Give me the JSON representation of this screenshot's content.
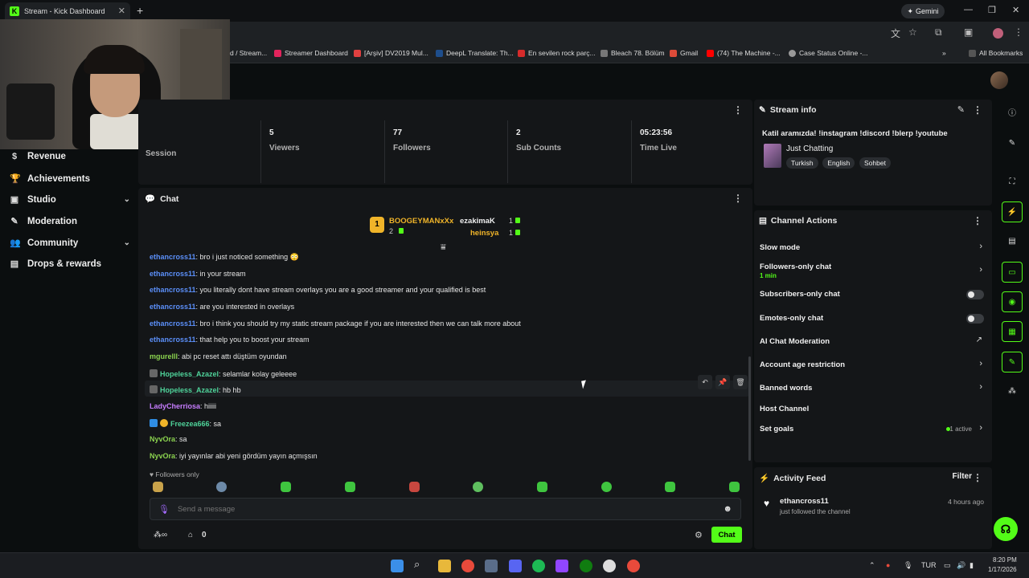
{
  "browser": {
    "tab_title": "Stream - Kick Dashboard",
    "tab_icon": "K",
    "new_tab": "+",
    "gemini_label": "Gemini",
    "bookmarks": [
      {
        "label": "d / Stream...",
        "color": "#444"
      },
      {
        "label": "Streamer Dashboard",
        "color": "#e2245c"
      },
      {
        "label": "[Arşiv] DV2019 Mul...",
        "color": "#e04040"
      },
      {
        "label": "DeepL Translate: Th...",
        "color": "#1e4e8c"
      },
      {
        "label": "En sevilen rock parç...",
        "color": "#d62b2b"
      },
      {
        "label": "Bleach 78. Bölüm",
        "color": "#777"
      },
      {
        "label": "Gmail",
        "color": "#dd4b39"
      },
      {
        "label": "(74) The Machine -...",
        "color": "#ff0000"
      },
      {
        "label": "Case Status Online -...",
        "color": "#999"
      }
    ],
    "all_bookmarks": "All Bookmarks"
  },
  "sidebar": {
    "items": [
      {
        "label": "Revenue",
        "icon": "dollar-icon",
        "chevron": false
      },
      {
        "label": "Achievements",
        "icon": "trophy-icon",
        "chevron": false
      },
      {
        "label": "Studio",
        "icon": "studio-icon",
        "chevron": true
      },
      {
        "label": "Moderation",
        "icon": "wrench-icon",
        "chevron": false
      },
      {
        "label": "Community",
        "icon": "people-icon",
        "chevron": true
      },
      {
        "label": "Drops & rewards",
        "icon": "gift-icon",
        "chevron": false
      }
    ]
  },
  "stats": {
    "session_label": "Session",
    "viewers_value": "5",
    "viewers_label": "Viewers",
    "followers_value": "77",
    "followers_label": "Followers",
    "subs_value": "2",
    "subs_label": "Sub Counts",
    "time_value": "05:23:56",
    "time_label": "Time Live"
  },
  "chat": {
    "title": "Chat",
    "leaderboard": {
      "first_rank": "1",
      "first_name": "BOOGEYMANxXx",
      "first_count": "2",
      "second_name": "ezakimaK",
      "second_count": "1",
      "third_name": "heinsya",
      "third_count": "1"
    },
    "messages": [
      {
        "user": "ethancross11",
        "text": ": bro i just noticed something 😳",
        "color": "#5b8ff9"
      },
      {
        "user": "ethancross11",
        "text": ": in your stream",
        "color": "#5b8ff9"
      },
      {
        "user": "ethancross11",
        "text": ": you literally dont have stream overlays you are a good streamer and your qualified is best",
        "color": "#5b8ff9"
      },
      {
        "user": "ethancross11",
        "text": ": are you interested in overlays",
        "color": "#5b8ff9"
      },
      {
        "user": "ethancross11",
        "text": ": bro i think you should try my static stream package if you are interested then we can talk more about",
        "color": "#5b8ff9"
      },
      {
        "user": "ethancross11",
        "text": ": that help you to boost your stream",
        "color": "#5b8ff9"
      },
      {
        "user": "mgurelll",
        "text": ": abi pc reset attı düştüm oyundan",
        "color": "#8bd34f"
      },
      {
        "user": "Hopeless_Azazel",
        "text": ": selamlar kolay geleeee",
        "color": "#4fd39a"
      },
      {
        "user": "Hopeless_Azazel",
        "text": ": hb hb",
        "color": "#4fd39a"
      },
      {
        "user": "LadyCherriosa",
        "text": ": hiiiii",
        "color": "#c77dff"
      },
      {
        "user": "Freezea666",
        "text": ": sa",
        "color": "#4fd39a"
      },
      {
        "user": "NyvOra",
        "text": ": sa",
        "color": "#8bd34f"
      },
      {
        "user": "NyvOra",
        "text": ": iyi yayınlar abi yeni gördüm yayın açmışsın",
        "color": "#8bd34f"
      }
    ],
    "followers_only": "Followers only",
    "input_placeholder": "Send a message",
    "points_value": "0",
    "send_label": "Chat"
  },
  "stream_info": {
    "title": "Stream info",
    "stream_title": "Katil aramızda! !instagram !discord !blerp !youtube",
    "category": "Just Chatting",
    "tags": [
      "Turkish",
      "English",
      "Sohbet"
    ]
  },
  "channel_actions": {
    "title": "Channel Actions",
    "slow_mode": "Slow mode",
    "followers_only": "Followers-only chat",
    "followers_only_sub": "1 min",
    "subscribers_only": "Subscribers-only chat",
    "emotes_only": "Emotes-only chat",
    "ai_moderation": "AI Chat Moderation",
    "age_restriction": "Account age restriction",
    "banned_words": "Banned words",
    "host_channel": "Host Channel",
    "set_goals": "Set goals",
    "goals_active": "1 active"
  },
  "activity": {
    "title": "Activity Feed",
    "filter": "Filter",
    "user": "ethancross11",
    "event": "just followed the channel",
    "time": "4 hours ago"
  },
  "taskbar": {
    "lang": "TUR",
    "time": "8:20 PM",
    "date": "1/17/2026"
  },
  "colors": {
    "accent": "#53fc18",
    "panel": "#141618",
    "background": "#0b0e0f"
  }
}
